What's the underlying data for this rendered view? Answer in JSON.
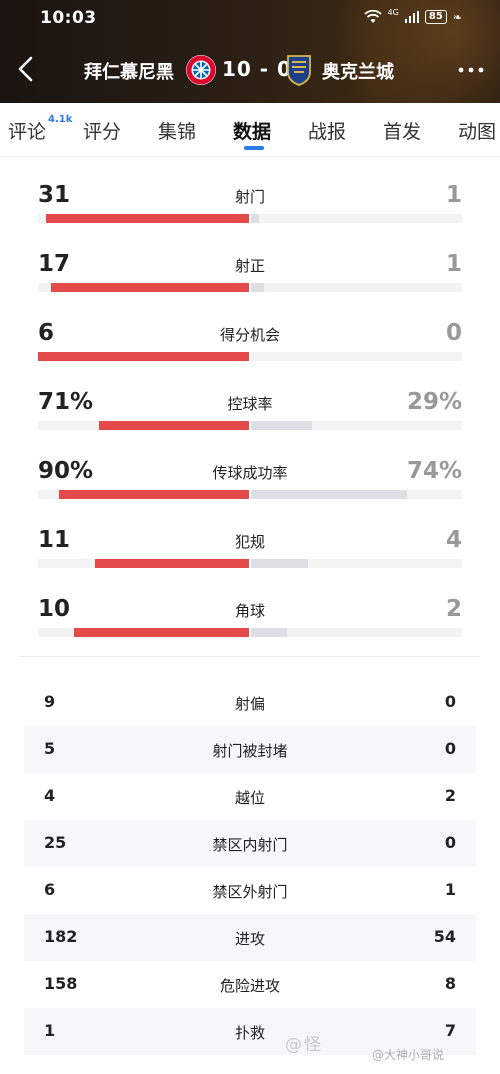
{
  "status": {
    "time": "10:03",
    "network": "4G",
    "battery": "85"
  },
  "match": {
    "home_team": "拜仁慕尼黑",
    "score": "10 - 0",
    "away_team": "奥克兰城"
  },
  "tabs": [
    {
      "label": "评论",
      "badge": "4.1k"
    },
    {
      "label": "评分"
    },
    {
      "label": "集锦"
    },
    {
      "label": "数据"
    },
    {
      "label": "战报"
    },
    {
      "label": "首发"
    },
    {
      "label": "动图"
    }
  ],
  "bar_stats": [
    {
      "label": "射门",
      "home": "31",
      "away": "1",
      "home_frac": 0.96,
      "away_frac": 0.04
    },
    {
      "label": "射正",
      "home": "17",
      "away": "1",
      "home_frac": 0.94,
      "away_frac": 0.06
    },
    {
      "label": "得分机会",
      "home": "6",
      "away": "0",
      "home_frac": 1.0,
      "away_frac": 0.0
    },
    {
      "label": "控球率",
      "home": "71%",
      "away": "29%",
      "home_frac": 0.71,
      "away_frac": 0.29
    },
    {
      "label": "传球成功率",
      "home": "90%",
      "away": "74%",
      "home_frac": 0.9,
      "away_frac": 0.74
    },
    {
      "label": "犯规",
      "home": "11",
      "away": "4",
      "home_frac": 0.73,
      "away_frac": 0.27
    },
    {
      "label": "角球",
      "home": "10",
      "away": "2",
      "home_frac": 0.83,
      "away_frac": 0.17
    }
  ],
  "plain_stats": [
    {
      "label": "射偏",
      "home": "9",
      "away": "0"
    },
    {
      "label": "射门被封堵",
      "home": "5",
      "away": "0"
    },
    {
      "label": "越位",
      "home": "4",
      "away": "2"
    },
    {
      "label": "禁区内射门",
      "home": "25",
      "away": "0"
    },
    {
      "label": "禁区外射门",
      "home": "6",
      "away": "1"
    },
    {
      "label": "进攻",
      "home": "182",
      "away": "54"
    },
    {
      "label": "危险进攻",
      "home": "158",
      "away": "8"
    },
    {
      "label": "扑救",
      "home": "1",
      "away": "7"
    }
  ],
  "watermark": {
    "text": "@怪",
    "small": "@大神小哥说"
  },
  "colors": {
    "home_bar": "#e54a4a",
    "away_bar": "#dcdfe3",
    "accent": "#2a7be4"
  }
}
